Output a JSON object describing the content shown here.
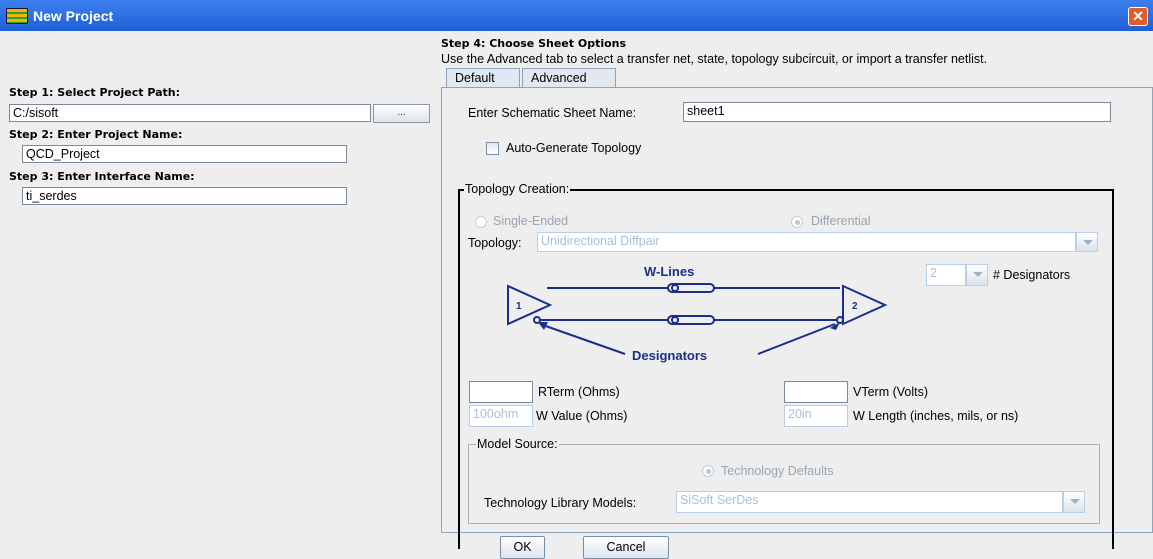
{
  "window": {
    "title": "New Project",
    "close_glyph": "✕"
  },
  "left": {
    "step1_label": "Step 1: Select Project Path:",
    "step1_value": "C:/sisoft",
    "browse_label": "...",
    "step2_label": "Step 2: Enter Project Name:",
    "step2_value": "QCD_Project",
    "step3_label": "Step 3: Enter Interface Name:",
    "step3_value": "ti_serdes"
  },
  "right": {
    "step4_title": "Step 4: Choose Sheet Options",
    "step4_desc": "Use the Advanced tab to select a transfer net, state, topology subcircuit, or import a transfer netlist.",
    "tabs": [
      {
        "label": "Default"
      },
      {
        "label": "Advanced"
      }
    ],
    "sheet_name_label": "Enter Schematic Sheet Name:",
    "sheet_name_value": "sheet1",
    "auto_generate_label": "Auto-Generate Topology",
    "topology_creation_legend": "Topology Creation:",
    "single_ended_label": "Single-Ended",
    "differential_label": "Differential",
    "topology_label": "Topology:",
    "topology_value": "Unidirectional Diffpair",
    "wlines_label": "W-Lines",
    "designators_label": "Designators",
    "driver_number": "1",
    "receiver_number": "2",
    "designators_count_value": "2",
    "designators_count_label": "# Designators",
    "rterm_value": "",
    "rterm_label": "RTerm (Ohms)",
    "vterm_value": "",
    "vterm_label": "VTerm (Volts)",
    "wvalue_value": "100ohm",
    "wvalue_label": "W Value (Ohms)",
    "wlength_value": "20in",
    "wlength_label": "W Length (inches, mils, or ns)",
    "model_source_legend": "Model Source:",
    "tech_defaults_label": "Technology Defaults",
    "tech_lib_label": "Technology Library Models:",
    "tech_lib_value": "SiSoft SerDes"
  },
  "buttons": {
    "ok": "OK",
    "cancel": "Cancel"
  },
  "colors": {
    "diagram_blue": "#1a2f8a",
    "titlebar": "#2a6ae6"
  }
}
